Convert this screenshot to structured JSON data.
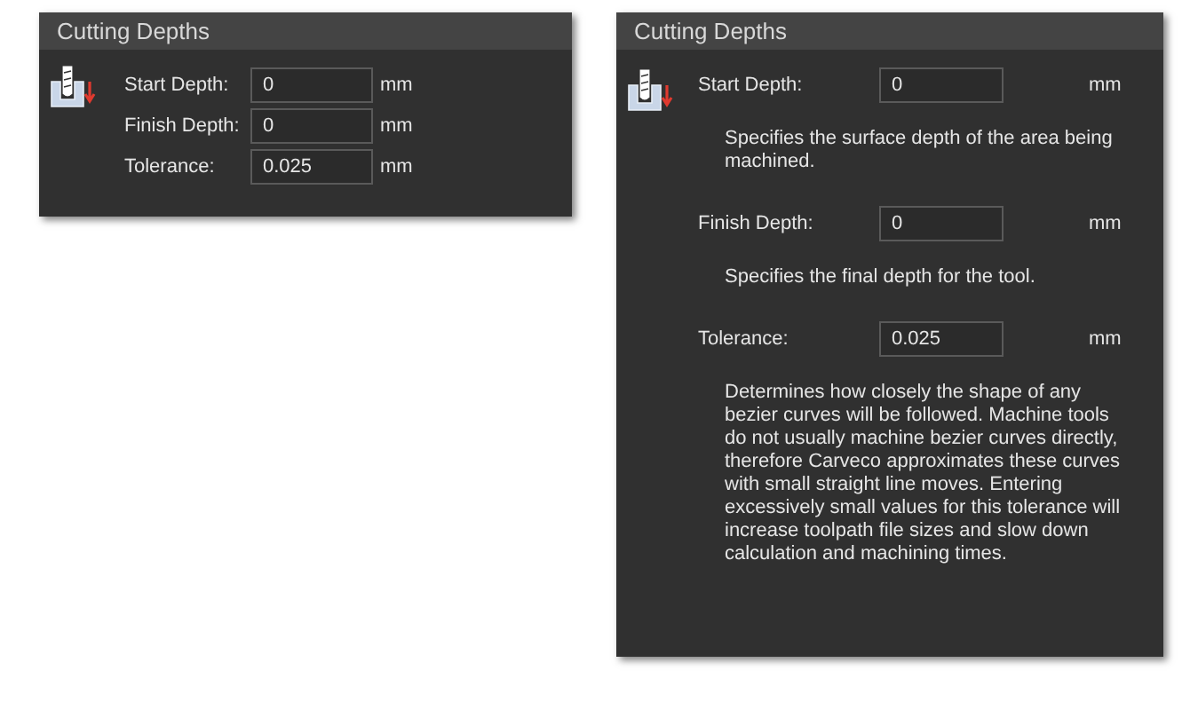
{
  "compact_panel": {
    "title": "Cutting Depths",
    "fields": [
      {
        "label": "Start Depth:",
        "value": "0",
        "unit": "mm"
      },
      {
        "label": "Finish Depth:",
        "value": "0",
        "unit": "mm"
      },
      {
        "label": "Tolerance:",
        "value": "0.025",
        "unit": "mm"
      }
    ]
  },
  "expanded_panel": {
    "title": "Cutting Depths",
    "fields": [
      {
        "label": "Start Depth:",
        "value": "0",
        "unit": "mm",
        "description": "Specifies the surface depth of the area being machined."
      },
      {
        "label": "Finish Depth:",
        "value": "0",
        "unit": "mm",
        "description": "Specifies the final depth for the tool."
      },
      {
        "label": "Tolerance:",
        "value": "0.025",
        "unit": "mm",
        "description": "Determines how closely the shape of any bezier curves will be followed. Machine tools do not usually machine bezier curves directly, therefore Carveco approximates these curves with small straight line moves. Entering excessively small values for this tolerance will increase toolpath file sizes and slow down calculation and machining times."
      }
    ]
  }
}
